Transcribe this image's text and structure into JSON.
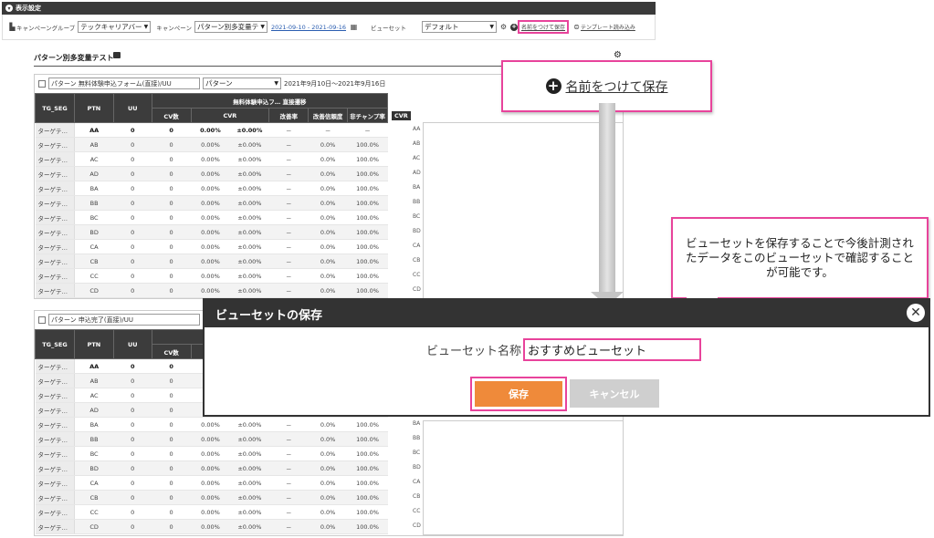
{
  "settings": {
    "title": "表示設定",
    "campaign_group_label": "キャンペーングループ",
    "campaign_group_value": "テックキャリアバー",
    "campaign_label": "キャンペーン",
    "campaign_value": "パターン別多変量テ",
    "date_range": "2021-09-10 - 2021-09-16",
    "viewset_label": "ビューセット",
    "viewset_value": "デフォルト",
    "save_named_label": "名前をつけて保存",
    "load_template_label": "テンプレート読み込み"
  },
  "section": {
    "title": "パターン別多変量テスト"
  },
  "table1": {
    "filter_text": "パターン 無料体験申込フォーム(直接)/UU",
    "dimension_value": "パターン",
    "date_label": "2021年9月10日〜2021年9月16日",
    "group_header": "無料体験申込フ… 直接遷移",
    "headers": [
      "TG_SEG",
      "PTN",
      "UU",
      "CV数",
      "CVR",
      "改善率",
      "改善信頼度",
      "非チャンプ率"
    ],
    "rows": [
      [
        "ターゲテ…",
        "AA",
        "0",
        "0",
        "0.00%",
        "±0.00%",
        "－",
        "－",
        "－"
      ],
      [
        "ターゲテ…",
        "AB",
        "0",
        "0",
        "0.00%",
        "±0.00%",
        "－",
        "0.0%",
        "100.0%"
      ],
      [
        "ターゲテ…",
        "AC",
        "0",
        "0",
        "0.00%",
        "±0.00%",
        "－",
        "0.0%",
        "100.0%"
      ],
      [
        "ターゲテ…",
        "AD",
        "0",
        "0",
        "0.00%",
        "±0.00%",
        "－",
        "0.0%",
        "100.0%"
      ],
      [
        "ターゲテ…",
        "BA",
        "0",
        "0",
        "0.00%",
        "±0.00%",
        "－",
        "0.0%",
        "100.0%"
      ],
      [
        "ターゲテ…",
        "BB",
        "0",
        "0",
        "0.00%",
        "±0.00%",
        "－",
        "0.0%",
        "100.0%"
      ],
      [
        "ターゲテ…",
        "BC",
        "0",
        "0",
        "0.00%",
        "±0.00%",
        "－",
        "0.0%",
        "100.0%"
      ],
      [
        "ターゲテ…",
        "BD",
        "0",
        "0",
        "0.00%",
        "±0.00%",
        "－",
        "0.0%",
        "100.0%"
      ],
      [
        "ターゲテ…",
        "CA",
        "0",
        "0",
        "0.00%",
        "±0.00%",
        "－",
        "0.0%",
        "100.0%"
      ],
      [
        "ターゲテ…",
        "CB",
        "0",
        "0",
        "0.00%",
        "±0.00%",
        "－",
        "0.0%",
        "100.0%"
      ],
      [
        "ターゲテ…",
        "CC",
        "0",
        "0",
        "0.00%",
        "±0.00%",
        "－",
        "0.0%",
        "100.0%"
      ],
      [
        "ターゲテ…",
        "CD",
        "0",
        "0",
        "0.00%",
        "±0.00%",
        "－",
        "0.0%",
        "100.0%"
      ]
    ],
    "cvr_badge": "CVR",
    "cvr_labels": [
      "AA",
      "AB",
      "AC",
      "AD",
      "BA",
      "BB",
      "BC",
      "BD",
      "CA",
      "CB",
      "CC",
      "CD"
    ]
  },
  "table2": {
    "filter_text": "パターン 申込完了(直接)/UU",
    "headers": [
      "TG_SEG",
      "PTN",
      "UU",
      "CV数"
    ],
    "rows": [
      [
        "ターゲテ…",
        "AA",
        "0",
        "0",
        "",
        "",
        "",
        "",
        ""
      ],
      [
        "ターゲテ…",
        "AB",
        "0",
        "0",
        "",
        "",
        "",
        "",
        ""
      ],
      [
        "ターゲテ…",
        "AC",
        "0",
        "0",
        "",
        "",
        "",
        "",
        ""
      ],
      [
        "ターゲテ…",
        "AD",
        "0",
        "0",
        "",
        "",
        "",
        "",
        ""
      ],
      [
        "ターゲテ…",
        "BA",
        "0",
        "0",
        "0.00%",
        "±0.00%",
        "－",
        "0.0%",
        "100.0%"
      ],
      [
        "ターゲテ…",
        "BB",
        "0",
        "0",
        "0.00%",
        "±0.00%",
        "－",
        "0.0%",
        "100.0%"
      ],
      [
        "ターゲテ…",
        "BC",
        "0",
        "0",
        "0.00%",
        "±0.00%",
        "－",
        "0.0%",
        "100.0%"
      ],
      [
        "ターゲテ…",
        "BD",
        "0",
        "0",
        "0.00%",
        "±0.00%",
        "－",
        "0.0%",
        "100.0%"
      ],
      [
        "ターゲテ…",
        "CA",
        "0",
        "0",
        "0.00%",
        "±0.00%",
        "－",
        "0.0%",
        "100.0%"
      ],
      [
        "ターゲテ…",
        "CB",
        "0",
        "0",
        "0.00%",
        "±0.00%",
        "－",
        "0.0%",
        "100.0%"
      ],
      [
        "ターゲテ…",
        "CC",
        "0",
        "0",
        "0.00%",
        "±0.00%",
        "－",
        "0.0%",
        "100.0%"
      ],
      [
        "ターゲテ…",
        "CD",
        "0",
        "0",
        "0.00%",
        "±0.00%",
        "－",
        "0.0%",
        "100.0%"
      ]
    ],
    "cvr_labels": [
      "BA",
      "BB",
      "BC",
      "BD",
      "CA",
      "CB",
      "CC",
      "CD"
    ]
  },
  "callout_save": {
    "text": "名前をつけて保存"
  },
  "callout_info": {
    "text": "ビューセットを保存することで今後計測されたデータをこのビューセットで確認することが可能です。"
  },
  "dialog": {
    "title": "ビューセットの保存",
    "name_label": "ビューセット名称",
    "name_value": "おすすめビューセット",
    "save_label": "保存",
    "cancel_label": "キャンセル"
  },
  "colors": {
    "accent_pink": "#e8439b",
    "save_orange": "#ef8a3a",
    "header_dark": "#333333"
  }
}
